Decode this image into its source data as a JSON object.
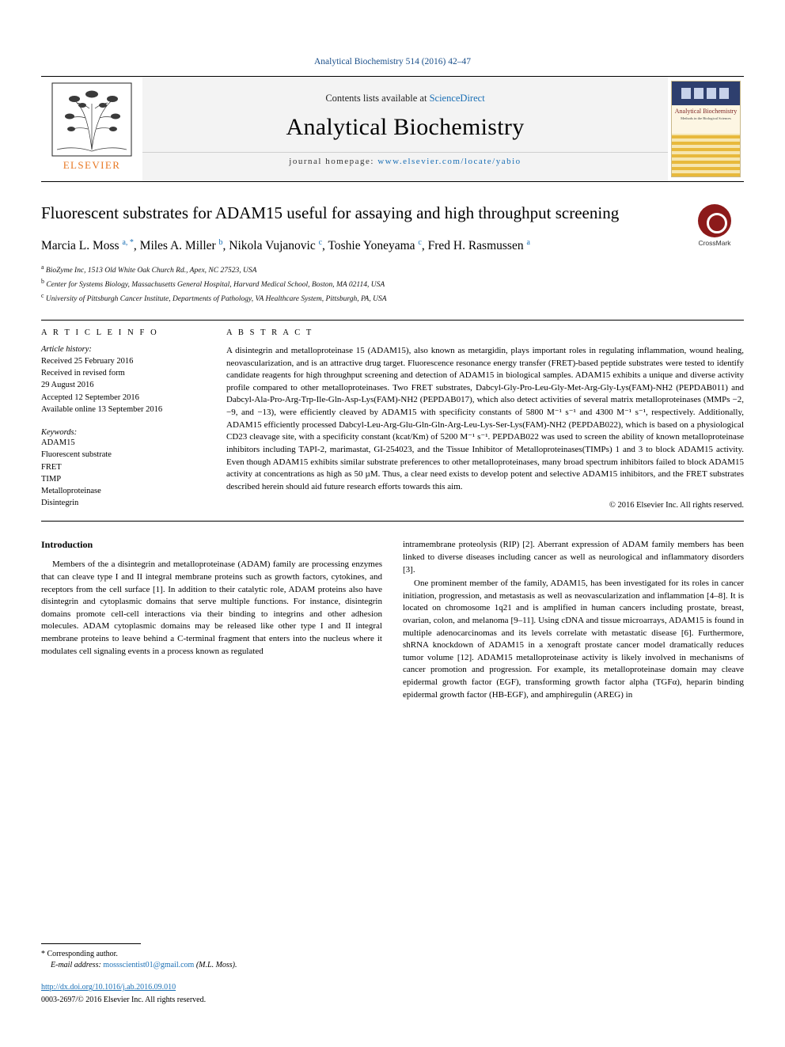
{
  "journal_ref": "Analytical Biochemistry 514 (2016) 42–47",
  "masthead": {
    "publisher": "ELSEVIER",
    "contents_prefix": "Contents lists available at ",
    "contents_link": "ScienceDirect",
    "journal_title": "Analytical Biochemistry",
    "homepage_prefix": "journal homepage: ",
    "homepage_link": "www.elsevier.com/locate/yabio",
    "cover": {
      "title": "Analytical Biochemistry",
      "subtitle": "Methods in the Biological Sciences"
    }
  },
  "article": {
    "title": "Fluorescent substrates for ADAM15 useful for assaying and high throughput screening",
    "crossmark_label": "CrossMark",
    "authors_html": "Marcia L. Moss <sup>a, *</sup>, Miles A. Miller <sup>b</sup>, Nikola Vujanovic <sup>c</sup>, Toshie Yoneyama <sup>c</sup>, Fred H. Rasmussen <sup>a</sup>",
    "affiliations": [
      "BioZyme Inc, 1513 Old White Oak Church Rd., Apex, NC 27523, USA",
      "Center for Systems Biology, Massachusetts General Hospital, Harvard Medical School, Boston, MA 02114, USA",
      "University of Pittsburgh Cancer Institute, Departments of Pathology, VA Healthcare System, Pittsburgh, PA, USA"
    ],
    "affiliation_marks": [
      "a",
      "b",
      "c"
    ]
  },
  "article_info": {
    "heading": "A R T I C L E   I N F O",
    "history_label": "Article history:",
    "history": [
      "Received 25 February 2016",
      "Received in revised form",
      "29 August 2016",
      "Accepted 12 September 2016",
      "Available online 13 September 2016"
    ],
    "keywords_label": "Keywords:",
    "keywords": [
      "ADAM15",
      "Fluorescent substrate",
      "FRET",
      "TIMP",
      "Metalloproteinase",
      "Disintegrin"
    ]
  },
  "abstract": {
    "heading": "A B S T R A C T",
    "text": "A disintegrin and metalloproteinase 15 (ADAM15), also known as metargidin, plays important roles in regulating inflammation, wound healing, neovascularization, and is an attractive drug target. Fluorescence resonance energy transfer (FRET)-based peptide substrates were tested to identify candidate reagents for high throughput screening and detection of ADAM15 in biological samples. ADAM15 exhibits a unique and diverse activity profile compared to other metalloproteinases. Two FRET substrates, Dabcyl-Gly-Pro-Leu-Gly-Met-Arg-Gly-Lys(FAM)-NH2 (PEPDAB011) and Dabcyl-Ala-Pro-Arg-Trp-Ile-Gln-Asp-Lys(FAM)-NH2 (PEPDAB017), which also detect activities of several matrix metalloproteinases (MMPs −2, −9, and −13), were efficiently cleaved by ADAM15 with specificity constants of 5800 M⁻¹ s⁻¹ and 4300 M⁻¹ s⁻¹, respectively. Additionally, ADAM15 efficiently processed Dabcyl-Leu-Arg-Glu-Gln-Gln-Arg-Leu-Lys-Ser-Lys(FAM)-NH2 (PEPDAB022), which is based on a physiological CD23 cleavage site, with a specificity constant (kcat/Km) of 5200 M⁻¹ s⁻¹. PEPDAB022 was used to screen the ability of known metalloproteinase inhibitors including TAPI-2, marimastat, GI-254023, and the Tissue Inhibitor of Metalloproteinases(TIMPs) 1 and 3 to block ADAM15 activity. Even though ADAM15 exhibits similar substrate preferences to other metalloproteinases, many broad spectrum inhibitors failed to block ADAM15 activity at concentrations as high as 50 µM. Thus, a clear need exists to develop potent and selective ADAM15 inhibitors, and the FRET substrates described herein should aid future research efforts towards this aim.",
    "copyright": "© 2016 Elsevier Inc. All rights reserved."
  },
  "body": {
    "intro_heading": "Introduction",
    "left_paragraphs": [
      "Members of the a disintegrin and metalloproteinase (ADAM) family are processing enzymes that can cleave type I and II integral membrane proteins such as growth factors, cytokines, and receptors from the cell surface [1]. In addition to their catalytic role, ADAM proteins also have disintegrin and cytoplasmic domains that serve multiple functions. For instance, disintegrin domains promote cell-cell interactions via their binding to integrins and other adhesion molecules. ADAM cytoplasmic domains may be released like other type I and II integral membrane proteins to leave behind a C-terminal fragment that enters into the nucleus where it modulates cell signaling events in a process known as regulated"
    ],
    "right_paragraphs": [
      "intramembrane proteolysis (RIP) [2]. Aberrant expression of ADAM family members has been linked to diverse diseases including cancer as well as neurological and inflammatory disorders [3].",
      "One prominent member of the family, ADAM15, has been investigated for its roles in cancer initiation, progression, and metastasis as well as neovascularization and inflammation [4–8]. It is located on chromosome 1q21 and is amplified in human cancers including prostate, breast, ovarian, colon, and melanoma [9–11]. Using cDNA and tissue microarrays, ADAM15 is found in multiple adenocarcinomas and its levels correlate with metastatic disease [6]. Furthermore, shRNA knockdown of ADAM15 in a xenograft prostate cancer model dramatically reduces tumor volume [12]. ADAM15 metalloproteinase activity is likely involved in mechanisms of cancer promotion and progression. For example, its metalloproteinase domain may cleave epidermal growth factor (EGF), transforming growth factor alpha (TGFα), heparin binding epidermal growth factor (HB-EGF), and amphiregulin (AREG) in"
    ]
  },
  "footer": {
    "corresponding_label": "* Corresponding author.",
    "email_label": "E-mail address: ",
    "email": "mossscientist01@gmail.com",
    "email_suffix": " (M.L. Moss).",
    "doi": "http://dx.doi.org/10.1016/j.ab.2016.09.010",
    "issn": "0003-2697/© 2016 Elsevier Inc. All rights reserved."
  },
  "colors": {
    "link": "#1a6fb5",
    "journal_ref": "#1a4f8a",
    "elsevier_orange": "#e87722",
    "crossmark_red": "#8c1a1a"
  }
}
